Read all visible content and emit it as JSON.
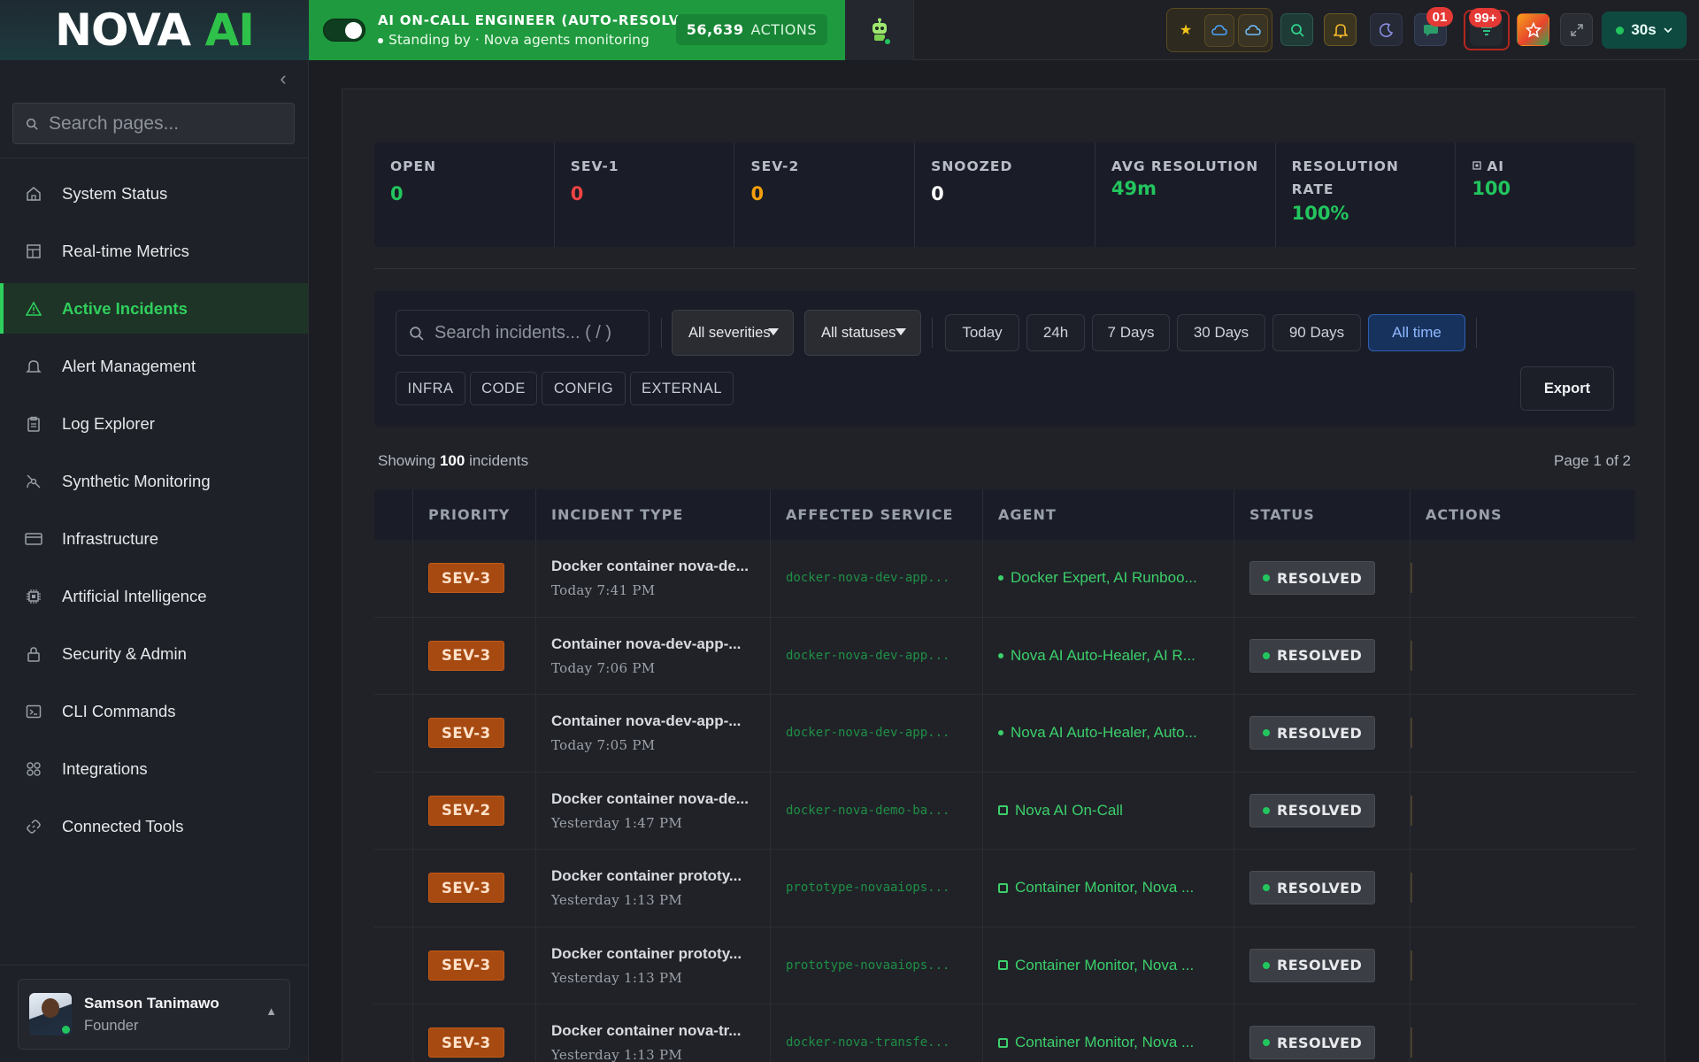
{
  "topbar": {
    "logo_main": "NOVA",
    "logo_accent": "AI",
    "oncall_title": "AI ON-CALL ENGINEER (AUTO-RESOLVE)",
    "oncall_status": "Standing by · Nova agents monitoring",
    "actions_count": "56,639",
    "actions_label": "ACTIONS",
    "messages_badge": "01",
    "alerts_badge": "99+",
    "refresh_interval": "30s",
    "icons": [
      "star-icon",
      "cloud-icon",
      "cloud-icon",
      "search-icon",
      "bell-icon",
      "moon-icon",
      "chat-icon",
      "filter-icon",
      "star-icon",
      "expand-icon"
    ]
  },
  "sidebar": {
    "search_placeholder": "Search pages...",
    "items": [
      {
        "label": "System Status",
        "icon": "home-icon"
      },
      {
        "label": "Real-time Metrics",
        "icon": "dashboard-icon"
      },
      {
        "label": "Active Incidents",
        "icon": "warning-icon",
        "active": true
      },
      {
        "label": "Alert Management",
        "icon": "bell-icon"
      },
      {
        "label": "Log Explorer",
        "icon": "clipboard-icon"
      },
      {
        "label": "Synthetic Monitoring",
        "icon": "satellite-icon"
      },
      {
        "label": "Infrastructure",
        "icon": "server-icon"
      },
      {
        "label": "Artificial Intelligence",
        "icon": "chip-icon"
      },
      {
        "label": "Security & Admin",
        "icon": "lock-icon"
      },
      {
        "label": "CLI Commands",
        "icon": "terminal-icon"
      },
      {
        "label": "Integrations",
        "icon": "grid-icon"
      },
      {
        "label": "Connected Tools",
        "icon": "link-icon"
      }
    ],
    "user": {
      "name": "Samson Tanimawo",
      "role": "Founder"
    }
  },
  "stats": [
    {
      "label": "OPEN",
      "value": "0",
      "color": "#22c55e"
    },
    {
      "label": "SEV-1",
      "value": "0",
      "color": "#ef4444"
    },
    {
      "label": "SEV-2",
      "value": "0",
      "color": "#f59e0b"
    },
    {
      "label": "SNOOZED",
      "value": "0",
      "color": "#ffffff"
    },
    {
      "label": "AVG RESOLUTION",
      "value": "49m",
      "color": "#22c55e"
    },
    {
      "label": "RESOLUTION RATE",
      "value": "100%",
      "color": "#22c55e"
    },
    {
      "label": "AI",
      "value": "100",
      "color": "#22c55e"
    }
  ],
  "filters": {
    "search_placeholder": "Search incidents... ( / )",
    "severity": "All severities",
    "status": "All statuses",
    "ranges": [
      "Today",
      "24h",
      "7 Days",
      "30 Days",
      "90 Days",
      "All time"
    ],
    "active_range": "All time",
    "tags": [
      "INFRA",
      "CODE",
      "CONFIG",
      "EXTERNAL"
    ],
    "export": "Export"
  },
  "summary": {
    "showing_prefix": "Showing",
    "count": "100",
    "showing_suffix": "incidents",
    "page": "Page 1 of 2"
  },
  "table": {
    "headers": [
      "",
      "PRIORITY",
      "INCIDENT TYPE",
      "AFFECTED SERVICE",
      "AGENT",
      "STATUS",
      "ACTIONS"
    ],
    "rows": [
      {
        "priority": "SEV-3",
        "title": "Docker container nova-de...",
        "time": "Today 7:41 PM",
        "service": "docker-nova-dev-app...",
        "agent": "Docker Expert, AI Runboo...",
        "agent_icon": "dot",
        "status": "RESOLVED"
      },
      {
        "priority": "SEV-3",
        "title": "Container nova-dev-app-...",
        "time": "Today 7:06 PM",
        "service": "docker-nova-dev-app...",
        "agent": "Nova AI Auto-Healer, AI R...",
        "agent_icon": "dot",
        "status": "RESOLVED"
      },
      {
        "priority": "SEV-3",
        "title": "Container nova-dev-app-...",
        "time": "Today 7:05 PM",
        "service": "docker-nova-dev-app...",
        "agent": "Nova AI Auto-Healer, Auto...",
        "agent_icon": "dot",
        "status": "RESOLVED"
      },
      {
        "priority": "SEV-2",
        "title": "Docker container nova-de...",
        "time": "Yesterday 1:47 PM",
        "service": "docker-nova-demo-ba...",
        "agent": "Nova AI On-Call",
        "agent_icon": "chip",
        "status": "RESOLVED"
      },
      {
        "priority": "SEV-3",
        "title": "Docker container prototy...",
        "time": "Yesterday 1:13 PM",
        "service": "prototype-novaaiops...",
        "agent": "Container Monitor, Nova ...",
        "agent_icon": "chip",
        "status": "RESOLVED"
      },
      {
        "priority": "SEV-3",
        "title": "Docker container prototy...",
        "time": "Yesterday 1:13 PM",
        "service": "prototype-novaaiops...",
        "agent": "Container Monitor, Nova ...",
        "agent_icon": "chip",
        "status": "RESOLVED"
      },
      {
        "priority": "SEV-3",
        "title": "Docker container nova-tr...",
        "time": "Yesterday 1:13 PM",
        "service": "docker-nova-transfe...",
        "agent": "Container Monitor, Nova ...",
        "agent_icon": "chip",
        "status": "RESOLVED"
      }
    ]
  }
}
